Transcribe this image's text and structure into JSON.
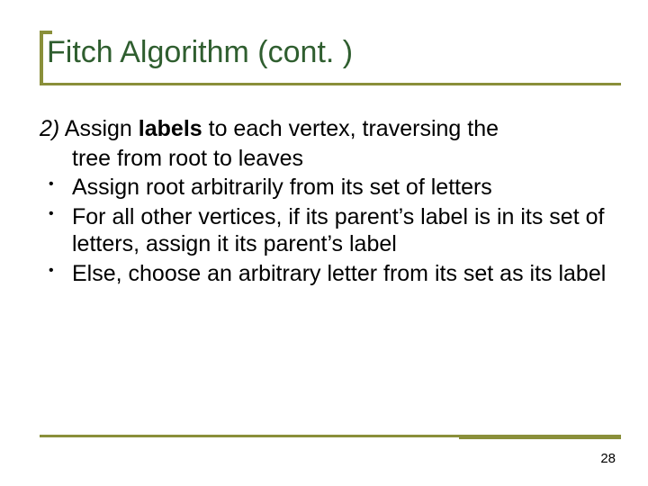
{
  "title": "Fitch Algorithm (cont. )",
  "body": {
    "step_label": "2)",
    "lead_before_bold": " Assign ",
    "lead_bold": "labels",
    "lead_after_bold": " to each vertex, traversing the",
    "lead_line2": "tree from root to leaves",
    "bullets": [
      "Assign root arbitrarily from its set of letters",
      "For all other vertices, if its parent’s label is in its set of letters, assign it its parent’s label",
      "Else, choose an arbitrary letter from its set as its label"
    ]
  },
  "page_number": "28"
}
